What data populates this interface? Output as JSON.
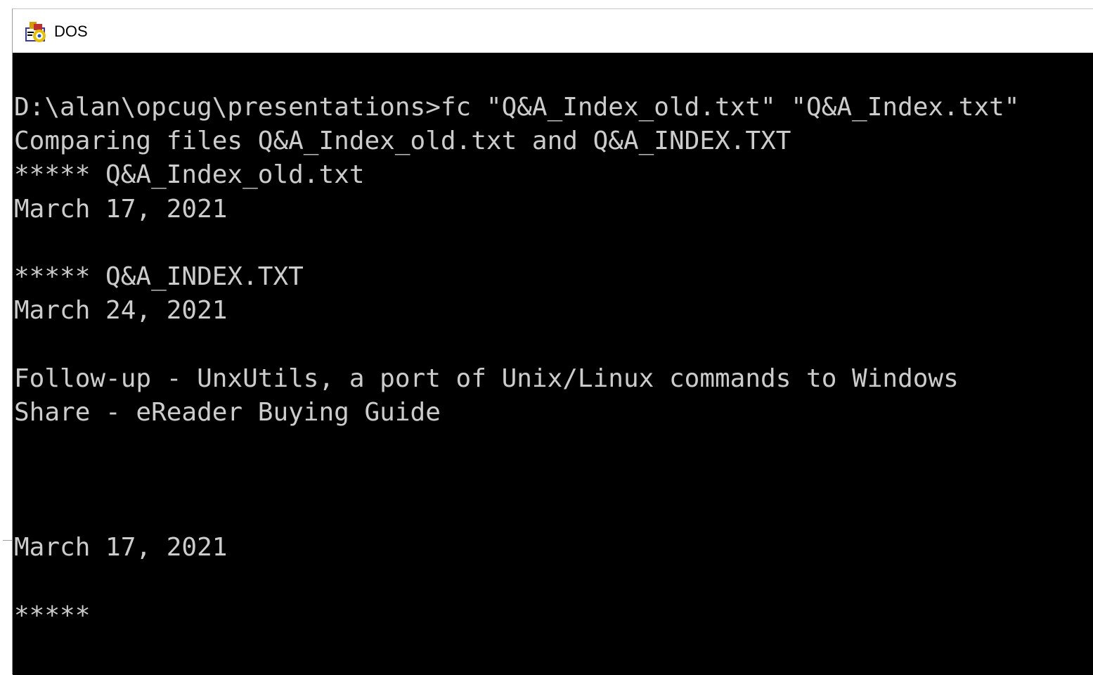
{
  "window": {
    "title": "DOS",
    "icon": "ms-dos-icon"
  },
  "console": {
    "lines": [
      "D:\\alan\\opcug\\presentations>fc \"Q&A_Index_old.txt\" \"Q&A_Index.txt\"",
      "Comparing files Q&A_Index_old.txt and Q&A_INDEX.TXT",
      "***** Q&A_Index_old.txt",
      "March 17, 2021",
      "",
      "***** Q&A_INDEX.TXT",
      "March 24, 2021",
      "",
      "Follow-up - UnxUtils, a port of Unix/Linux commands to Windows",
      "Share - eReader Buying Guide",
      "",
      "",
      "",
      "March 17, 2021",
      "",
      "*****"
    ]
  },
  "colors": {
    "console_bg": "#000000",
    "console_fg": "#cccccc",
    "titlebar_bg": "#ffffff"
  }
}
